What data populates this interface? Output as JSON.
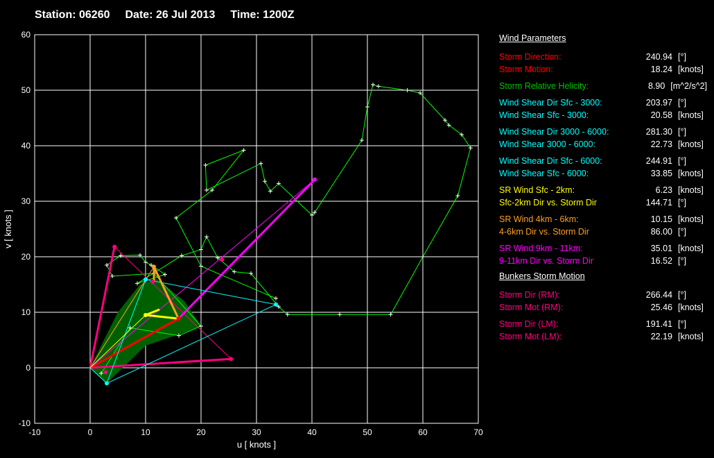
{
  "header": {
    "station": "Station: 06260",
    "date": "Date: 26 Jul 2013",
    "time": "Time: 1200Z"
  },
  "panel": {
    "title": "Wind Parameters",
    "groups": [
      [
        {
          "label": "Storm Direction:",
          "value": "240.94",
          "unit": "[°]",
          "color": "#ff0000"
        },
        {
          "label": "Storm Motion:",
          "value": "18.24",
          "unit": "[knots]",
          "color": "#ff0000"
        }
      ],
      [
        {
          "label": "Storm Relative Helicity:",
          "value": "8.90",
          "unit": "[m^2/s^2]",
          "color": "#00c000"
        }
      ],
      [
        {
          "label": "Wind Shear Dir Sfc - 3000:",
          "value": "203.97",
          "unit": "[°]",
          "color": "#00ffff"
        },
        {
          "label": "Wind Shear Sfc - 3000:",
          "value": "20.58",
          "unit": "[knots]",
          "color": "#00ffff"
        }
      ],
      [
        {
          "label": "Wind Shear Dir 3000 - 6000:",
          "value": "281.30",
          "unit": "[°]",
          "color": "#00ffff"
        },
        {
          "label": "Wind Shear 3000 - 6000:",
          "value": "22.73",
          "unit": "[knots]",
          "color": "#00ffff"
        }
      ],
      [
        {
          "label": "Wind Shear Dir Sfc - 6000:",
          "value": "244.91",
          "unit": "[°]",
          "color": "#00ffff"
        },
        {
          "label": "Wind Shear Sfc - 6000:",
          "value": "33.85",
          "unit": "[knots]",
          "color": "#00ffff"
        }
      ],
      [
        {
          "label": "SR Wind Sfc - 2km:",
          "value": "6.23",
          "unit": "[knots]",
          "color": "#ffff00"
        },
        {
          "label": "Sfc-2km Dir vs. Storm Dir",
          "value": "144.71",
          "unit": "[°]",
          "color": "#ffff00"
        }
      ],
      [
        {
          "label": "SR Wind 4km - 6km:",
          "value": "10.15",
          "unit": "[knots]",
          "color": "#ffa020"
        },
        {
          "label": "4-6km Dir vs. Storm Dir",
          "value": "86.00",
          "unit": "[°]",
          "color": "#ffa020"
        }
      ],
      [
        {
          "label": "SR Wind 9km - 11km:",
          "value": "35.01",
          "unit": "[knots]",
          "color": "#ff00ff"
        },
        {
          "label": "9-11km Dir vs. Storm Dir",
          "value": "16.52",
          "unit": "[°]",
          "color": "#ff00ff"
        }
      ]
    ],
    "bunkers_title": "Bunkers Storm Motion",
    "bunkers": [
      [
        {
          "label": "Storm Dir (RM):",
          "value": "266.44",
          "unit": "[°]",
          "color": "#ff0080"
        },
        {
          "label": "Storm Mot (RM):",
          "value": "25.46",
          "unit": "[knots]",
          "color": "#ff0080"
        }
      ],
      [
        {
          "label": "Storm Dir (LM):",
          "value": "191.41",
          "unit": "[°]",
          "color": "#ff0080"
        },
        {
          "label": "Storm Mot (LM):",
          "value": "22.19",
          "unit": "[knots]",
          "color": "#ff0080"
        }
      ]
    ]
  },
  "chart_data": {
    "type": "line",
    "title": "Hodograph",
    "xlabel": "u  [ knots ]",
    "ylabel": "v  [ knots ]",
    "xlim": [
      -10,
      70
    ],
    "ylim": [
      -10,
      60
    ],
    "xticks": [
      -10,
      0,
      10,
      20,
      30,
      40,
      50,
      60,
      70
    ],
    "yticks": [
      -10,
      0,
      10,
      20,
      30,
      40,
      50,
      60
    ],
    "grid": true,
    "shaded_area": {
      "color": "#006000",
      "points": [
        [
          0,
          0
        ],
        [
          3,
          -2.8
        ],
        [
          10,
          4
        ],
        [
          16,
          6
        ],
        [
          20,
          7.5
        ],
        [
          17,
          12
        ],
        [
          12,
          16
        ],
        [
          9,
          15
        ],
        [
          5,
          10
        ]
      ]
    },
    "series": [
      {
        "name": "hodograph",
        "color": "#00ff00",
        "markers": true,
        "points": [
          [
            2,
            -1
          ],
          [
            7.2,
            7.2
          ],
          [
            16,
            5.8
          ],
          [
            20,
            7.5
          ],
          [
            11.5,
            17
          ],
          [
            4,
            16.5
          ],
          [
            3,
            18.5
          ],
          [
            5.5,
            20.2
          ],
          [
            9,
            20.3
          ],
          [
            10,
            19
          ],
          [
            11,
            18.5
          ],
          [
            13.5,
            16.8
          ],
          [
            8.5,
            15.2
          ],
          [
            16.5,
            20.2
          ],
          [
            20,
            21.3
          ],
          [
            21,
            23.6
          ],
          [
            23,
            19.8
          ],
          [
            26,
            17.3
          ],
          [
            29,
            17
          ],
          [
            34,
            11
          ],
          [
            35.6,
            9.6
          ],
          [
            45,
            9.6
          ],
          [
            54.2,
            9.6
          ],
          [
            60,
            20
          ],
          [
            66.3,
            31
          ],
          [
            68.6,
            39.6
          ],
          [
            67,
            42
          ],
          [
            64.7,
            43.7
          ],
          [
            64,
            44.6
          ],
          [
            59.5,
            49.5
          ],
          [
            57.2,
            50
          ],
          [
            52,
            50.7
          ],
          [
            51,
            51
          ],
          [
            50,
            47
          ],
          [
            49,
            41
          ],
          [
            40.5,
            28
          ],
          [
            40,
            27.5
          ],
          [
            34,
            33.2
          ],
          [
            32.5,
            31.8
          ],
          [
            31.5,
            33.6
          ],
          [
            30.8,
            36.8
          ],
          [
            21,
            32
          ],
          [
            20.8,
            36.5
          ],
          [
            27.7,
            39.2
          ],
          [
            22,
            32
          ],
          [
            15.5,
            27
          ],
          [
            20,
            18.3
          ],
          [
            33.5,
            12.5
          ]
        ]
      },
      {
        "name": "storm-motion",
        "color": "#ff0000",
        "width": 3,
        "points": [
          [
            0,
            0
          ],
          [
            15.94,
            8.86
          ]
        ]
      },
      {
        "name": "sr-9-11km",
        "color": "#ff00ff",
        "width": 3,
        "points": [
          [
            15.94,
            8.86
          ],
          [
            40.5,
            33.9
          ]
        ]
      },
      {
        "name": "sr-9-11km-thin",
        "color": "#ff00ff",
        "width": 1,
        "points": [
          [
            0,
            0
          ],
          [
            40.5,
            33.9
          ]
        ]
      },
      {
        "name": "bunkers-rm",
        "color": "#ff0080",
        "width": 3,
        "points": [
          [
            0,
            0
          ],
          [
            25.4,
            1.6
          ]
        ]
      },
      {
        "name": "bunkers-lm",
        "color": "#ff0080",
        "width": 3,
        "points": [
          [
            0,
            0
          ],
          [
            4.4,
            21.8
          ]
        ]
      },
      {
        "name": "bunkers-thin",
        "color": "#ff0080",
        "width": 1,
        "points": [
          [
            4.4,
            21.8
          ],
          [
            25.4,
            1.6
          ]
        ]
      },
      {
        "name": "shear",
        "color": "#00ffff",
        "width": 1,
        "points": [
          [
            0,
            0
          ],
          [
            3,
            -2.8
          ],
          [
            10,
            15.9
          ],
          [
            33.5,
            11.4
          ],
          [
            3,
            -2.8
          ]
        ]
      },
      {
        "name": "sr-sfc-2km",
        "color": "#ffff00",
        "width": 3,
        "points": [
          [
            15.94,
            8.86
          ],
          [
            10,
            9.5
          ],
          [
            12.5,
            10.5
          ]
        ]
      },
      {
        "name": "sr-4-6km",
        "color": "#ffa020",
        "width": 3,
        "points": [
          [
            15.94,
            8.86
          ],
          [
            11.5,
            18.2
          ],
          [
            11.5,
            15.5
          ]
        ]
      },
      {
        "name": "sr-4-6km-thin",
        "color": "#ffa020",
        "width": 1,
        "points": [
          [
            0,
            0
          ],
          [
            11.5,
            18.2
          ]
        ]
      },
      {
        "name": "sr-sfc-2km-thin",
        "color": "#ffff00",
        "width": 1,
        "points": [
          [
            0,
            0
          ],
          [
            10,
            9.5
          ]
        ]
      }
    ],
    "dots": [
      {
        "color": "#ff0000",
        "points": [
          [
            15.94,
            8.86
          ]
        ]
      },
      {
        "color": "#ff00ff",
        "points": [
          [
            40.5,
            33.9
          ]
        ]
      },
      {
        "color": "#ff0080",
        "points": [
          [
            25.4,
            1.6
          ],
          [
            4.4,
            21.8
          ],
          [
            11.3,
            15.5
          ],
          [
            23.8,
            19.5
          ],
          [
            2.8,
            -0.8
          ]
        ]
      },
      {
        "color": "#00ffff",
        "points": [
          [
            3,
            -2.8
          ],
          [
            10,
            15.9
          ],
          [
            33.5,
            11.4
          ]
        ]
      },
      {
        "color": "#ffff00",
        "points": [
          [
            10,
            9.5
          ]
        ]
      },
      {
        "color": "#ffa020",
        "points": [
          [
            11.5,
            18.2
          ]
        ]
      }
    ]
  }
}
